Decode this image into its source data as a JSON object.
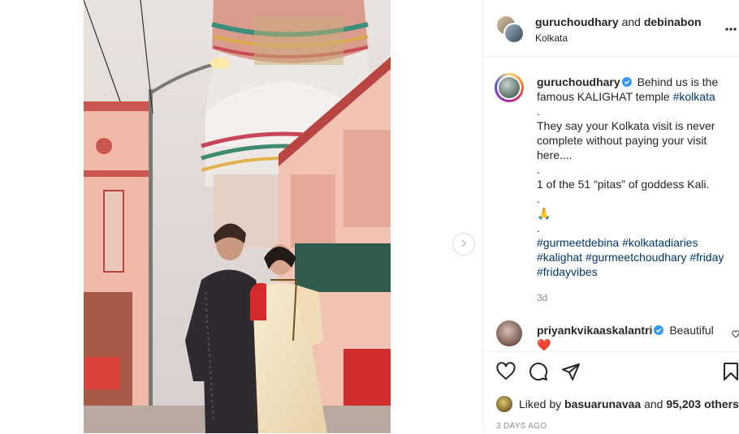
{
  "header": {
    "user1": "guruchoudhary",
    "joiner": "and",
    "user2": "debinabon",
    "location": "Kolkata"
  },
  "caption": {
    "username": "guruchoudhary",
    "text1": "Behind us is the famous KALIGHAT temple",
    "tag1": "#kolkata",
    "dot": ".",
    "text2": "They say your Kolkata visit is never complete without paying your visit here....",
    "text3": "1 of the 51 “pitas” of goddess Kali.",
    "emoji": "🙏",
    "tags": [
      "#gurmeetdebina",
      "#kolkatadiaries",
      "#kalighat",
      "#gurmeetchoudhary",
      "#friday",
      "#fridayvibes"
    ],
    "time": "3d"
  },
  "comment": {
    "username": "priyankvikaaskalantri",
    "text": "Beautiful",
    "emoji": "❤️"
  },
  "likes": {
    "prefix": "Liked by",
    "user": "basuarunavaa",
    "joiner": "and",
    "count": "95,203 others"
  },
  "date": "3 DAYS AGO",
  "icons": [
    "more-options-icon",
    "verified-badge-icon",
    "heart-icon",
    "comment-icon",
    "share-icon",
    "bookmark-icon",
    "chevron-right-icon"
  ],
  "colors": {
    "link": "#00376b",
    "verified": "#3897f0",
    "muted": "#8e8e8e"
  }
}
